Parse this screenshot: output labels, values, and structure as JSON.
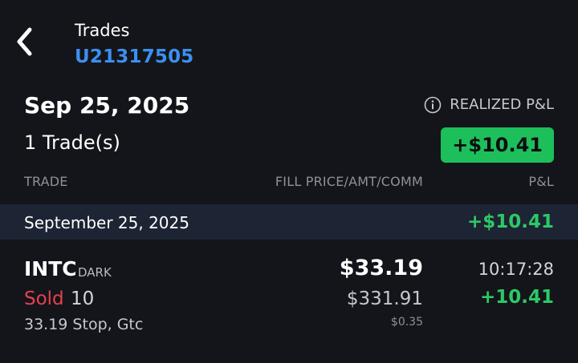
{
  "header": {
    "back_icon": "chevron-left-icon",
    "title": "Trades",
    "account": "U21317505"
  },
  "summary": {
    "date": "Sep 25, 2025",
    "trade_count": "1 Trade(s)",
    "realized_label": "REALIZED P&L",
    "info_icon": "info-circle-icon",
    "realized_pnl": "+$10.41"
  },
  "columns": {
    "trade": "TRADE",
    "fill": "FILL PRICE/AMT/COMM",
    "pnl": "P&L"
  },
  "groups": [
    {
      "date": "September 25, 2025",
      "pnl": "+$10.41",
      "trades": [
        {
          "symbol": "INTC",
          "venue": "DARK",
          "side": "Sold",
          "quantity": "10",
          "order": "33.19 Stop, Gtc",
          "fill_price": "$33.19",
          "amount": "$331.91",
          "commission": "$0.35",
          "time": "10:17:28",
          "pnl": "+10.41"
        }
      ]
    }
  ],
  "colors": {
    "background": "#13151a",
    "band": "#1d2433",
    "accent_blue": "#3d8ff0",
    "positive_green": "#2ec866",
    "badge_green": "#1dbf5b",
    "sell_red": "#e5414d"
  }
}
